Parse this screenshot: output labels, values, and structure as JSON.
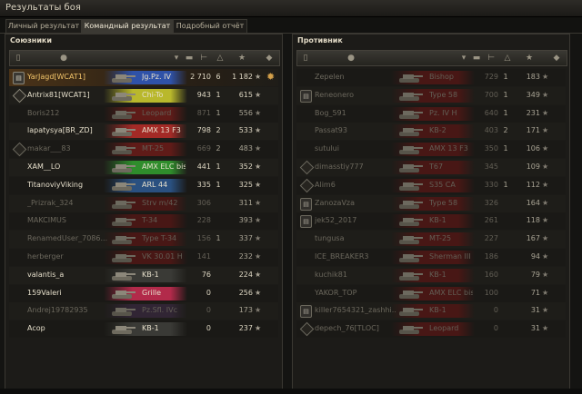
{
  "window": {
    "title": "Результаты боя"
  },
  "tabs": [
    {
      "label": "Личный результат"
    },
    {
      "label": "Командный результат"
    },
    {
      "label": "Подробный отчёт"
    }
  ],
  "allies": {
    "title": "Союзники",
    "rows": [
      {
        "name": "YarJagd[WCAT1]",
        "vehicle": "Jg.Pz. IV",
        "damage": "2 710",
        "kills": "6",
        "xp": "1 182",
        "status": "player",
        "tag": "squad",
        "color": "#2f52a8",
        "medal": "gear-medal"
      },
      {
        "name": "Antrix81[WCAT1]",
        "vehicle": "Chi-To",
        "damage": "943",
        "kills": "1",
        "xp": "615",
        "status": "alive",
        "tag": "platoon",
        "color": "#b9b82c"
      },
      {
        "name": "Boris212",
        "vehicle": "Leopard",
        "damage": "871",
        "kills": "1",
        "xp": "556",
        "status": "dead",
        "tag": "",
        "color": "#7a1b18"
      },
      {
        "name": "lapatysya[BR_ZD]",
        "vehicle": "AMX 13 F3",
        "damage": "798",
        "kills": "2",
        "xp": "533",
        "status": "alive",
        "tag": "",
        "color": "#a32a26"
      },
      {
        "name": "makar___83",
        "vehicle": "MT-25",
        "damage": "669",
        "kills": "2",
        "xp": "483",
        "status": "dead",
        "tag": "platoon",
        "color": "#7a1b18"
      },
      {
        "name": "XAM__LO",
        "vehicle": "AMX ELC bis",
        "damage": "441",
        "kills": "1",
        "xp": "352",
        "status": "alive",
        "tag": "",
        "color": "#2f8d2c"
      },
      {
        "name": "TitanoviyViking",
        "vehicle": "ARL 44",
        "damage": "335",
        "kills": "1",
        "xp": "325",
        "status": "alive",
        "tag": "",
        "color": "#2a5080"
      },
      {
        "name": "_Prizrak_324",
        "vehicle": "Strv m/42",
        "damage": "306",
        "kills": "",
        "xp": "311",
        "status": "dead",
        "tag": "",
        "color": "#5a1614"
      },
      {
        "name": "MAKCIMUS",
        "vehicle": "T-34",
        "damage": "228",
        "kills": "",
        "xp": "393",
        "status": "dead",
        "tag": "",
        "color": "#5a1614"
      },
      {
        "name": "RenamedUser_7086...",
        "vehicle": "Type T-34",
        "damage": "156",
        "kills": "1",
        "xp": "337",
        "status": "dead",
        "tag": "",
        "color": "#5a1614"
      },
      {
        "name": "herberger",
        "vehicle": "VK 30.01 H",
        "damage": "141",
        "kills": "",
        "xp": "232",
        "status": "dead",
        "tag": "",
        "color": "#5a1614"
      },
      {
        "name": "valantis_a",
        "vehicle": "KB-1",
        "damage": "76",
        "kills": "",
        "xp": "224",
        "status": "alive",
        "tag": "",
        "color": "#3a3a36"
      },
      {
        "name": "159Valeri",
        "vehicle": "Grille",
        "damage": "0",
        "kills": "",
        "xp": "256",
        "status": "alive",
        "tag": "",
        "color": "#b22a4a"
      },
      {
        "name": "Andrej19782935",
        "vehicle": "Pz.Sfl. IVc",
        "damage": "0",
        "kills": "",
        "xp": "173",
        "status": "dead",
        "tag": "",
        "color": "#3a2a40"
      },
      {
        "name": "Acop",
        "vehicle": "KB-1",
        "damage": "0",
        "kills": "",
        "xp": "237",
        "status": "alive",
        "tag": "",
        "color": "#3a3a36"
      }
    ]
  },
  "enemies": {
    "title": "Противник",
    "rows": [
      {
        "name": "Zepelen",
        "vehicle": "Bishop",
        "damage": "729",
        "kills": "1",
        "xp": "183",
        "status": "dead",
        "tag": "",
        "color": "#5a1614"
      },
      {
        "name": "Reneonero",
        "vehicle": "Type 58",
        "damage": "700",
        "kills": "1",
        "xp": "349",
        "status": "dead",
        "tag": "squad",
        "color": "#5a1614"
      },
      {
        "name": "Bog_591",
        "vehicle": "Pz. IV H",
        "damage": "640",
        "kills": "1",
        "xp": "231",
        "status": "dead",
        "tag": "",
        "color": "#5a1614"
      },
      {
        "name": "Passat93",
        "vehicle": "KB-2",
        "damage": "403",
        "kills": "2",
        "xp": "171",
        "status": "dead",
        "tag": "",
        "color": "#5a1614"
      },
      {
        "name": "sutului",
        "vehicle": "AMX 13 F3",
        "damage": "350",
        "kills": "1",
        "xp": "106",
        "status": "dead",
        "tag": "",
        "color": "#5a1614"
      },
      {
        "name": "dimasstiy777",
        "vehicle": "T67",
        "damage": "345",
        "kills": "",
        "xp": "109",
        "status": "dead",
        "tag": "platoon",
        "color": "#5a1614"
      },
      {
        "name": "Alim6",
        "vehicle": "S35 CA",
        "damage": "330",
        "kills": "1",
        "xp": "112",
        "status": "dead",
        "tag": "platoon",
        "color": "#5a1614"
      },
      {
        "name": "ZanozaVza",
        "vehicle": "Type 58",
        "damage": "326",
        "kills": "",
        "xp": "164",
        "status": "dead",
        "tag": "squad",
        "color": "#5a1614"
      },
      {
        "name": "jek52_2017",
        "vehicle": "KB-1",
        "damage": "261",
        "kills": "",
        "xp": "118",
        "status": "dead",
        "tag": "squad",
        "color": "#5a1614"
      },
      {
        "name": "tungusa",
        "vehicle": "MT-25",
        "damage": "227",
        "kills": "",
        "xp": "167",
        "status": "dead",
        "tag": "",
        "color": "#5a1614"
      },
      {
        "name": "ICE_BREAKER3",
        "vehicle": "Sherman III",
        "damage": "186",
        "kills": "",
        "xp": "94",
        "status": "dead",
        "tag": "",
        "color": "#5a1614"
      },
      {
        "name": "kuchik81",
        "vehicle": "KB-1",
        "damage": "160",
        "kills": "",
        "xp": "79",
        "status": "dead",
        "tag": "",
        "color": "#5a1614"
      },
      {
        "name": "YAKOR_TOP",
        "vehicle": "AMX ELC bis",
        "damage": "100",
        "kills": "",
        "xp": "71",
        "status": "dead",
        "tag": "",
        "color": "#5a1614"
      },
      {
        "name": "killer7654321_zashhi...",
        "vehicle": "KB-1",
        "damage": "0",
        "kills": "",
        "xp": "31",
        "status": "dead",
        "tag": "squad",
        "color": "#5a1614"
      },
      {
        "name": "depech_76[TLOC]",
        "vehicle": "Leopard",
        "damage": "0",
        "kills": "",
        "xp": "31",
        "status": "dead",
        "tag": "platoon",
        "color": "#5a1614"
      }
    ]
  },
  "header_icons": [
    "squad-icon",
    "player-icon",
    "sort-arrow-icon",
    "vehicle-icon",
    "damage-icon",
    "kills-icon",
    "xp-star-icon",
    "medal-icon"
  ]
}
